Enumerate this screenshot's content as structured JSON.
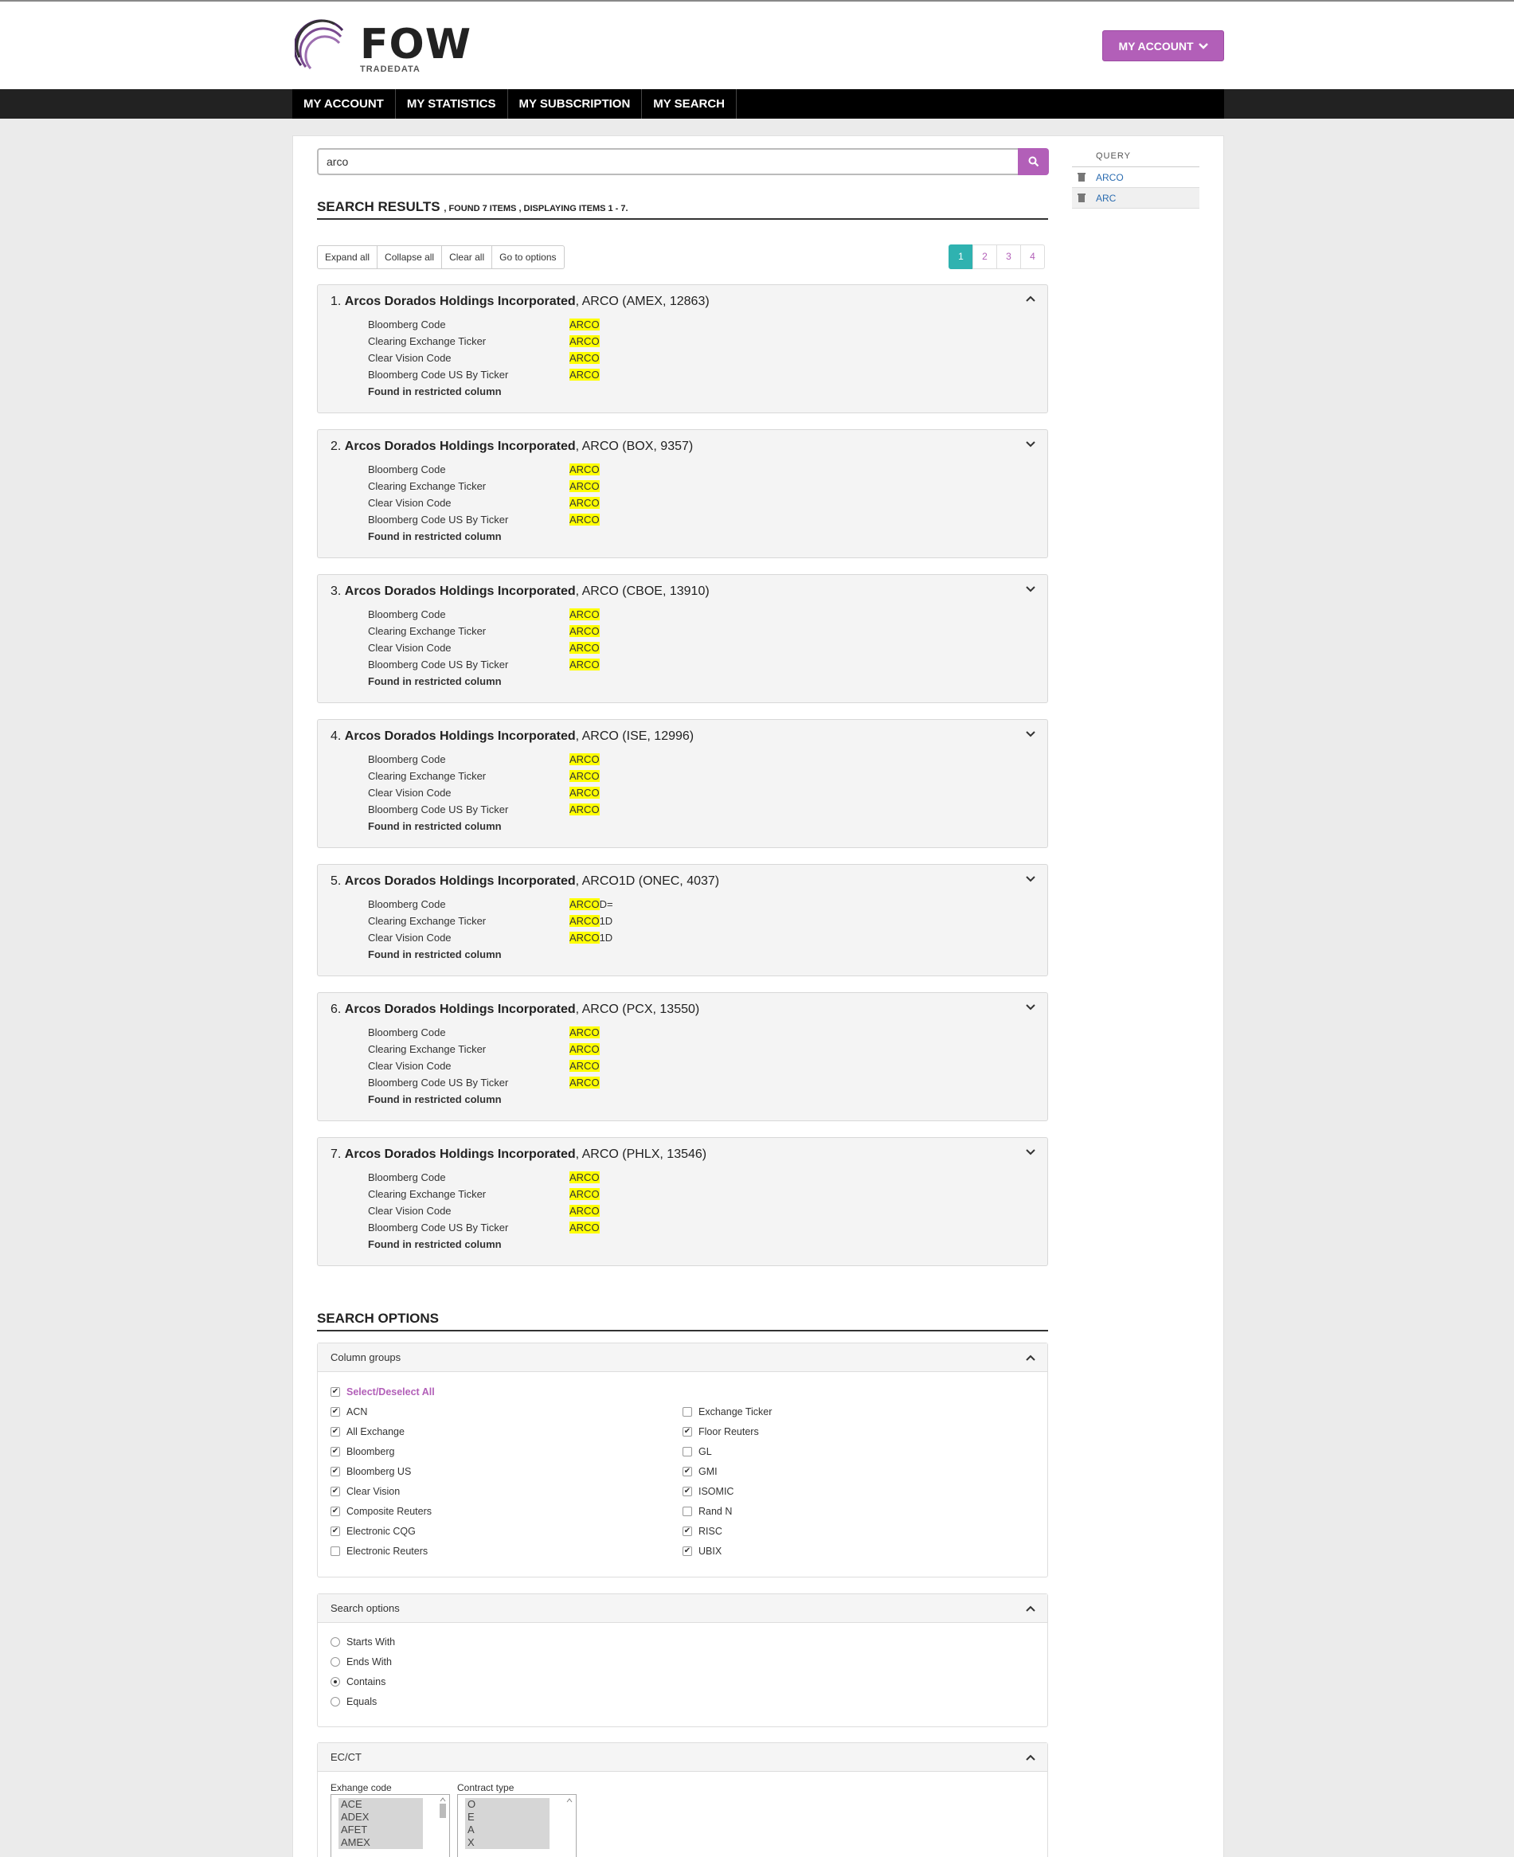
{
  "header": {
    "logo_text": "FOW",
    "logo_sub": "TRADEDATA",
    "account_button": "MY ACCOUNT"
  },
  "nav": [
    "MY ACCOUNT",
    "MY STATISTICS",
    "MY SUBSCRIPTION",
    "MY SEARCH"
  ],
  "search": {
    "value": "arco",
    "placeholder": ""
  },
  "results_header": {
    "title": "SEARCH RESULTS",
    "summary": ", FOUND 7 ITEMS , DISPLAYING ITEMS 1 - 7."
  },
  "toolbar": {
    "expand_all": "Expand all",
    "collapse_all": "Collapse all",
    "clear_all": "Clear all",
    "go_to_options": "Go to options"
  },
  "pagination": {
    "pages": [
      "1",
      "2",
      "3",
      "4"
    ],
    "active": "1"
  },
  "results": [
    {
      "num": "1.",
      "name": "Arcos Dorados Holdings Incorporated",
      "rest": ", ARCO (AMEX, 12863)",
      "rows": [
        {
          "label": "Bloomberg Code",
          "hl": "ARCO",
          "tail": ""
        },
        {
          "label": "Clearing Exchange Ticker",
          "hl": "ARCO",
          "tail": ""
        },
        {
          "label": "Clear Vision Code",
          "hl": "ARCO",
          "tail": ""
        },
        {
          "label": "Bloomberg Code US By Ticker",
          "hl": "ARCO",
          "tail": ""
        }
      ],
      "found": "Found in restricted column",
      "expanded": true
    },
    {
      "num": "2.",
      "name": "Arcos Dorados Holdings Incorporated",
      "rest": ", ARCO (BOX, 9357)",
      "rows": [
        {
          "label": "Bloomberg Code",
          "hl": "ARCO",
          "tail": ""
        },
        {
          "label": "Clearing Exchange Ticker",
          "hl": "ARCO",
          "tail": ""
        },
        {
          "label": "Clear Vision Code",
          "hl": "ARCO",
          "tail": ""
        },
        {
          "label": "Bloomberg Code US By Ticker",
          "hl": "ARCO",
          "tail": ""
        }
      ],
      "found": "Found in restricted column",
      "expanded": false
    },
    {
      "num": "3.",
      "name": "Arcos Dorados Holdings Incorporated",
      "rest": ", ARCO (CBOE, 13910)",
      "rows": [
        {
          "label": "Bloomberg Code",
          "hl": "ARCO",
          "tail": ""
        },
        {
          "label": "Clearing Exchange Ticker",
          "hl": "ARCO",
          "tail": ""
        },
        {
          "label": "Clear Vision Code",
          "hl": "ARCO",
          "tail": ""
        },
        {
          "label": "Bloomberg Code US By Ticker",
          "hl": "ARCO",
          "tail": ""
        }
      ],
      "found": "Found in restricted column",
      "expanded": false
    },
    {
      "num": "4.",
      "name": "Arcos Dorados Holdings Incorporated",
      "rest": ", ARCO (ISE, 12996)",
      "rows": [
        {
          "label": "Bloomberg Code",
          "hl": "ARCO",
          "tail": ""
        },
        {
          "label": "Clearing Exchange Ticker",
          "hl": "ARCO",
          "tail": ""
        },
        {
          "label": "Clear Vision Code",
          "hl": "ARCO",
          "tail": ""
        },
        {
          "label": "Bloomberg Code US By Ticker",
          "hl": "ARCO",
          "tail": ""
        }
      ],
      "found": "Found in restricted column",
      "expanded": false
    },
    {
      "num": "5.",
      "name": "Arcos Dorados Holdings Incorporated",
      "rest": ", ARCO1D (ONEC, 4037)",
      "rows": [
        {
          "label": "Bloomberg Code",
          "hl": "ARCO",
          "tail": "D="
        },
        {
          "label": "Clearing Exchange Ticker",
          "hl": "ARCO",
          "tail": "1D"
        },
        {
          "label": "Clear Vision Code",
          "hl": "ARCO",
          "tail": "1D"
        }
      ],
      "found": "Found in restricted column",
      "expanded": false
    },
    {
      "num": "6.",
      "name": "Arcos Dorados Holdings Incorporated",
      "rest": ", ARCO (PCX, 13550)",
      "rows": [
        {
          "label": "Bloomberg Code",
          "hl": "ARCO",
          "tail": ""
        },
        {
          "label": "Clearing Exchange Ticker",
          "hl": "ARCO",
          "tail": ""
        },
        {
          "label": "Clear Vision Code",
          "hl": "ARCO",
          "tail": ""
        },
        {
          "label": "Bloomberg Code US By Ticker",
          "hl": "ARCO",
          "tail": ""
        }
      ],
      "found": "Found in restricted column",
      "expanded": false
    },
    {
      "num": "7.",
      "name": "Arcos Dorados Holdings Incorporated",
      "rest": ", ARCO (PHLX, 13546)",
      "rows": [
        {
          "label": "Bloomberg Code",
          "hl": "ARCO",
          "tail": ""
        },
        {
          "label": "Clearing Exchange Ticker",
          "hl": "ARCO",
          "tail": ""
        },
        {
          "label": "Clear Vision Code",
          "hl": "ARCO",
          "tail": ""
        },
        {
          "label": "Bloomberg Code US By Ticker",
          "hl": "ARCO",
          "tail": ""
        }
      ],
      "found": "Found in restricted column",
      "expanded": false
    }
  ],
  "options": {
    "title": "SEARCH OPTIONS",
    "column_groups": {
      "title": "Column groups",
      "select_all": "Select/Deselect All",
      "left": [
        {
          "label": "ACN",
          "checked": true
        },
        {
          "label": "All Exchange",
          "checked": true
        },
        {
          "label": "Bloomberg",
          "checked": true
        },
        {
          "label": "Bloomberg US",
          "checked": true
        },
        {
          "label": "Clear Vision",
          "checked": true
        },
        {
          "label": "Composite Reuters",
          "checked": true
        },
        {
          "label": "Electronic CQG",
          "checked": true
        },
        {
          "label": "Electronic Reuters",
          "checked": false
        }
      ],
      "right": [
        {
          "label": "Exchange Ticker",
          "checked": false
        },
        {
          "label": "Floor Reuters",
          "checked": true
        },
        {
          "label": "GL",
          "checked": false
        },
        {
          "label": "GMI",
          "checked": true
        },
        {
          "label": "ISOMIC",
          "checked": true
        },
        {
          "label": "Rand N",
          "checked": false
        },
        {
          "label": "RISC",
          "checked": true
        },
        {
          "label": "UBIX",
          "checked": true
        }
      ]
    },
    "search_options": {
      "title": "Search options",
      "items": [
        {
          "label": "Starts With",
          "selected": false
        },
        {
          "label": "Ends With",
          "selected": false
        },
        {
          "label": "Contains",
          "selected": true
        },
        {
          "label": "Equals",
          "selected": false
        }
      ]
    },
    "ecct": {
      "title": "EC/CT",
      "exchange_label": "Exhange code",
      "exchange_codes": [
        "ACE",
        "ADEX",
        "AFET",
        "AMEX"
      ],
      "contract_label": "Contract type",
      "contract_types": [
        "O",
        "E",
        "A",
        "X"
      ]
    }
  },
  "sidebar": {
    "heading": "QUERY",
    "items": [
      "ARCO",
      "ARC"
    ]
  },
  "colors": {
    "accent": "#b25fb8",
    "active_page": "#2fb2b0",
    "highlight": "#ffff00"
  }
}
